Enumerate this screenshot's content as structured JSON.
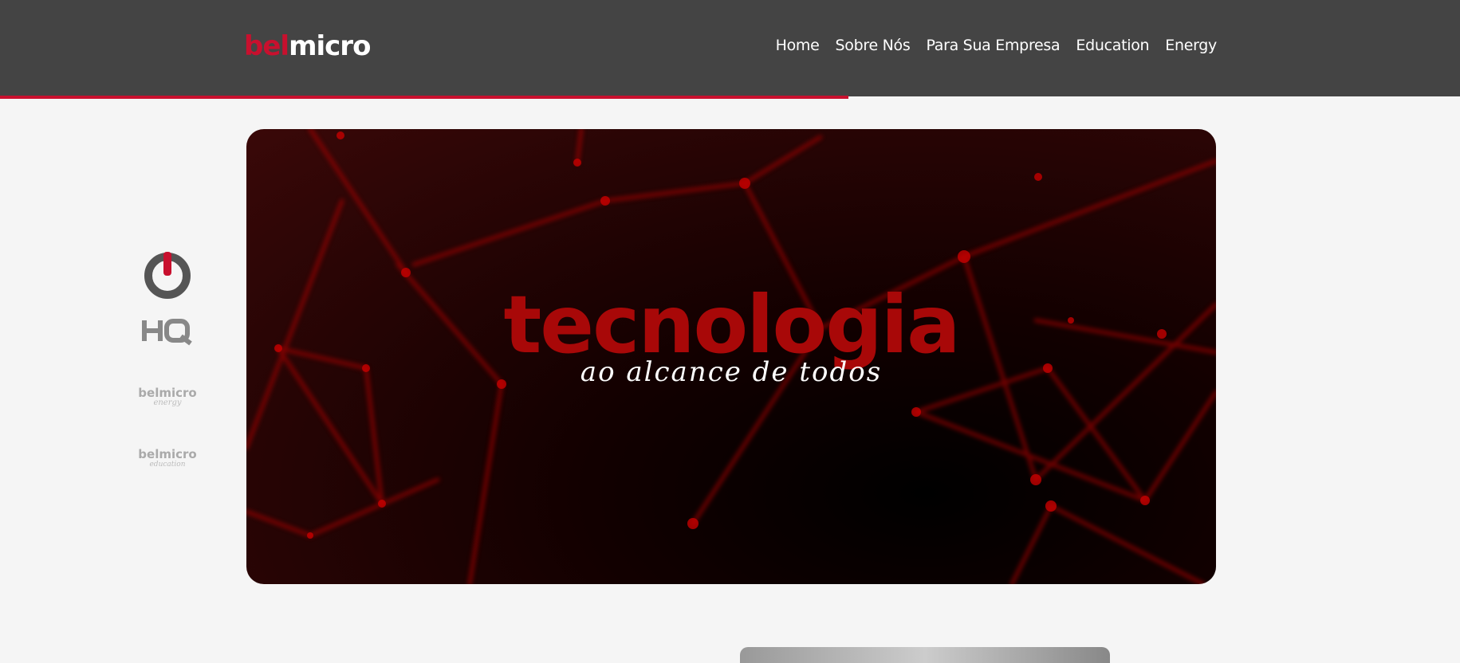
{
  "header": {
    "logo": {
      "part1": "bel",
      "part2": "micro"
    },
    "nav": [
      "Home",
      "Sobre Nós",
      "Para Sua Empresa",
      "Education",
      "Energy"
    ]
  },
  "sidebar": {
    "items": [
      {
        "name": "power"
      },
      {
        "name": "HQ",
        "label": "HQ"
      },
      {
        "name": "belmicro energy",
        "label": "belmicro",
        "sub": "energy"
      },
      {
        "name": "belmicro education",
        "label": "belmicro",
        "sub": "education"
      }
    ]
  },
  "hero": {
    "title": "tecnologia",
    "subtitle": "ao alcance de todos"
  },
  "colors": {
    "brand_red": "#c8102e",
    "header_bg": "#444444",
    "page_bg": "#f5f5f5"
  }
}
